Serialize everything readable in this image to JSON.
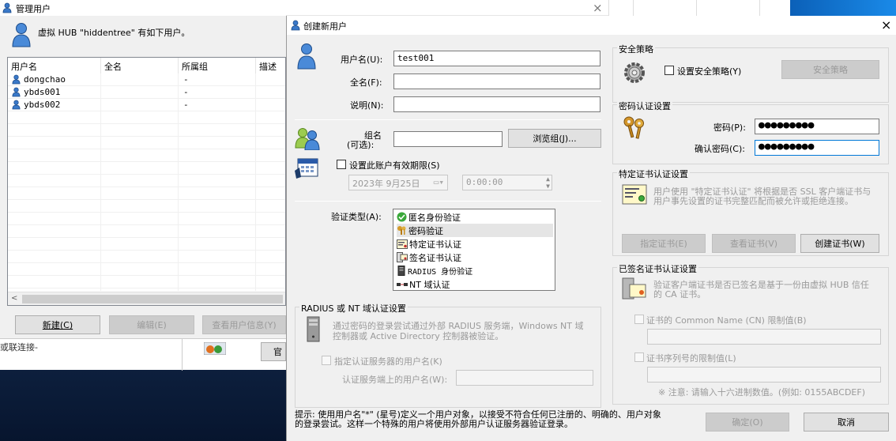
{
  "left_window": {
    "title": "管理用户",
    "header_text": "虚拟 HUB \"hiddentree\" 有如下用户。",
    "columns": [
      "用户名",
      "全名",
      "所属组",
      "描述"
    ],
    "rows": [
      {
        "name": "dongchao",
        "fullname": "",
        "group": "-",
        "desc": ""
      },
      {
        "name": "ybds001",
        "fullname": "",
        "group": "-",
        "desc": ""
      },
      {
        "name": "ybds002",
        "fullname": "",
        "group": "-",
        "desc": ""
      }
    ],
    "btn_new": "新建(C)",
    "btn_edit": "编辑(E)",
    "btn_view": "查看用户信息(Y)",
    "status_text": "或联连接-",
    "partial_btn": "官"
  },
  "bg_close": "×",
  "dialog": {
    "title": "创建新用户",
    "close": "×",
    "username_label": "用户名(U):",
    "username_value": "test001",
    "fullname_label": "全名(F):",
    "fullname_value": "",
    "note_label": "说明(N):",
    "note_value": "",
    "group_label_1": "组名",
    "group_label_2": "(可选):",
    "group_value": "",
    "browse_group": "浏览组(J)...",
    "expire_label": "设置此账户有效期限(S)",
    "date_value": "2023年  9月25日",
    "time_value": "0:00:00",
    "auth_type_label": "验证类型(A):",
    "auth_types": [
      {
        "label": "匿名身份验证",
        "icon": "check-circle-icon",
        "selected": false
      },
      {
        "label": "密码验证",
        "icon": "keys-icon",
        "selected": true
      },
      {
        "label": "特定证书认证",
        "icon": "certificate-icon",
        "selected": false
      },
      {
        "label": "签名证书认证",
        "icon": "signed-cert-icon",
        "selected": false
      },
      {
        "label": "RADIUS 身份验证",
        "icon": "server-icon",
        "selected": false
      },
      {
        "label": "NT 域认证",
        "icon": "network-icon",
        "selected": false
      }
    ],
    "radius_group_title": "RADIUS 或 NT 域认证设置",
    "radius_desc_1": "通过密码的登录尝试通过外部 RADIUS 服务端，Windows NT 域",
    "radius_desc_2": "控制器或 Active Directory 控制器被验证。",
    "radius_specify_label": "指定认证服务器的用户名(K)",
    "radius_username_label": "认证服务端上的用户名(W):",
    "security_group_title": "安全策略",
    "security_check_label": "设置安全策略(Y)",
    "security_btn": "安全策略",
    "password_group_title": "密码认证设置",
    "password_label": "密码(P):",
    "password_value": "●●●●●●●●●",
    "confirm_label": "确认密码(C):",
    "confirm_value": "●●●●●●●●●",
    "cert_group_title": "特定证书认证设置",
    "cert_desc_1": "用户使用 \"特定证书认证\" 将根据是否 SSL 客户端证书与",
    "cert_desc_2": "用户事先设置的证书完整匹配而被允许或拒绝连接。",
    "btn_specify_cert": "指定证书(E)",
    "btn_view_cert": "查看证书(V)",
    "btn_create_cert": "创建证书(W)",
    "signed_group_title": "已签名证书认证设置",
    "signed_desc_1": "验证客户端证书是否已签名是基于一份由虚拟 HUB 信任",
    "signed_desc_2": "的 CA 证书。",
    "cn_label": "证书的 Common Name (CN) 限制值(B)",
    "serial_label": "证书序列号的限制值(L)",
    "hex_note": "※ 注意: 请输入十六进制数值。(例如: 0155ABCDEF)",
    "hint_1": "提示: 使用用户名\"*\" (星号)定义一个用户对象，以接受不符合任何已注册的、明确的、用户对象",
    "hint_2": "的登录尝试。这样一个特殊的用户将使用外部用户认证服务器验证登录。",
    "btn_ok": "确定(O)",
    "btn_cancel": "取消"
  },
  "colors": {
    "accent": "#0078d7",
    "window_bg": "#f0f0f0",
    "desktop": "#0c2a5a"
  }
}
